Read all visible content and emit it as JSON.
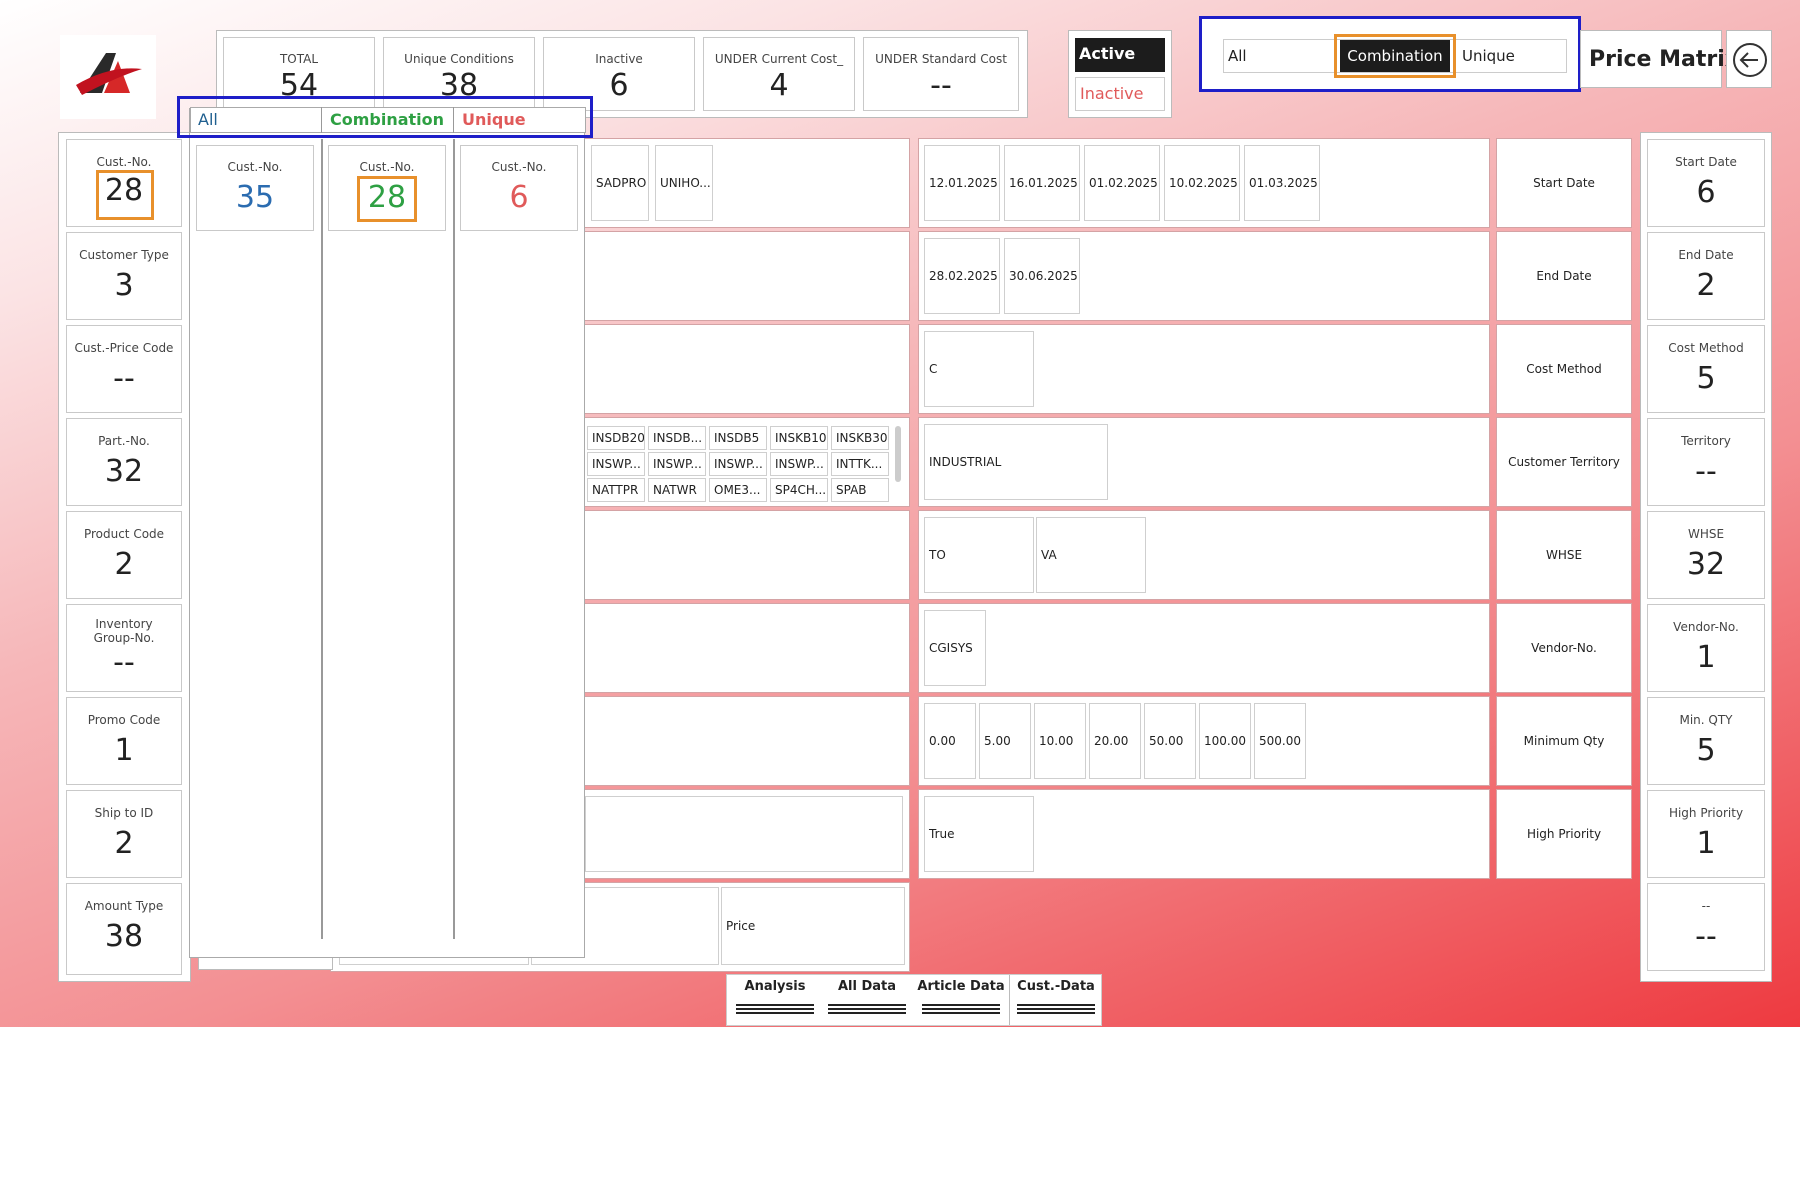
{
  "app": {
    "title": "Price Matrix"
  },
  "kpis": [
    {
      "label": "TOTAL",
      "value": "54"
    },
    {
      "label": "Unique Conditions",
      "value": "38"
    },
    {
      "label": "Inactive",
      "value": "6"
    },
    {
      "label": "UNDER Current Cost_",
      "value": "4"
    },
    {
      "label": "UNDER Standard Cost",
      "value": "--"
    }
  ],
  "status": {
    "active": "Active",
    "inactive": "Inactive"
  },
  "mode_tabs": {
    "all": "All",
    "combination": "Combination",
    "unique": "Unique",
    "selected": "Combination"
  },
  "dropdown": {
    "tabs": {
      "all": "All",
      "combination": "Combination",
      "unique": "Unique"
    },
    "cards": [
      {
        "label": "Cust.-No.",
        "value": "35",
        "color": "#2b6cb0"
      },
      {
        "label": "Cust.-No.",
        "value": "28",
        "color": "#2ea043"
      },
      {
        "label": "Cust.-No.",
        "value": "6",
        "color": "#e05a5a"
      }
    ]
  },
  "left_cards": [
    {
      "label": "Cust.-No.",
      "value": "28"
    },
    {
      "label": "Customer Type",
      "value": "3"
    },
    {
      "label": "Cust.-Price Code",
      "value": "--"
    },
    {
      "label": "Part.-No.",
      "value": "32"
    },
    {
      "label": "Product Code",
      "value": "2"
    },
    {
      "label": "Inventory Group-No.",
      "value": "--"
    },
    {
      "label": "Promo Code",
      "value": "1"
    },
    {
      "label": "Ship to ID",
      "value": "2"
    },
    {
      "label": "Amount Type",
      "value": "38"
    }
  ],
  "mid_rows": {
    "row1": [
      "SADPRO",
      "UNIHO..."
    ],
    "row4": [
      "INSDB20",
      "INSDB...",
      "INSDB5",
      "INSKB10",
      "INSKB30",
      "INSWP...",
      "INSWP...",
      "INSWP...",
      "INSWP...",
      "INTTK...",
      "NATTPR",
      "NATWR",
      "OME3...",
      "SP4CH...",
      "SPAB"
    ],
    "row9": "Price"
  },
  "conditions": [
    {
      "field": "Start Date",
      "values": [
        "12.01.2025",
        "16.01.2025",
        "01.02.2025",
        "10.02.2025",
        "01.03.2025"
      ]
    },
    {
      "field": "End Date",
      "values": [
        "28.02.2025",
        "30.06.2025"
      ]
    },
    {
      "field": "Cost Method",
      "values": [
        "C"
      ]
    },
    {
      "field": "Customer Territory",
      "values": [
        "INDUSTRIAL"
      ]
    },
    {
      "field": "WHSE",
      "values": [
        "TO",
        "VA"
      ]
    },
    {
      "field": "Vendor-No.",
      "values": [
        "CGISYS"
      ]
    },
    {
      "field": "Minimum Qty",
      "values": [
        "0.00",
        "5.00",
        "10.00",
        "20.00",
        "50.00",
        "100.00",
        "500.00"
      ]
    },
    {
      "field": "High Priority",
      "values": [
        "True"
      ]
    }
  ],
  "right_cards": [
    {
      "label": "Start Date",
      "value": "6"
    },
    {
      "label": "End Date",
      "value": "2"
    },
    {
      "label": "Cost Method",
      "value": "5"
    },
    {
      "label": "Territory",
      "value": "--"
    },
    {
      "label": "WHSE",
      "value": "32"
    },
    {
      "label": "Vendor-No.",
      "value": "1"
    },
    {
      "label": "Min. QTY",
      "value": "5"
    },
    {
      "label": "High Priority",
      "value": "1"
    },
    {
      "label": "--",
      "value": "--"
    }
  ],
  "bottom_tabs": [
    "Analysis",
    "All Data",
    "Article Data",
    "Cust.-Data"
  ],
  "icons": {
    "logo": "company-logo",
    "back": "back-arrow-icon"
  }
}
